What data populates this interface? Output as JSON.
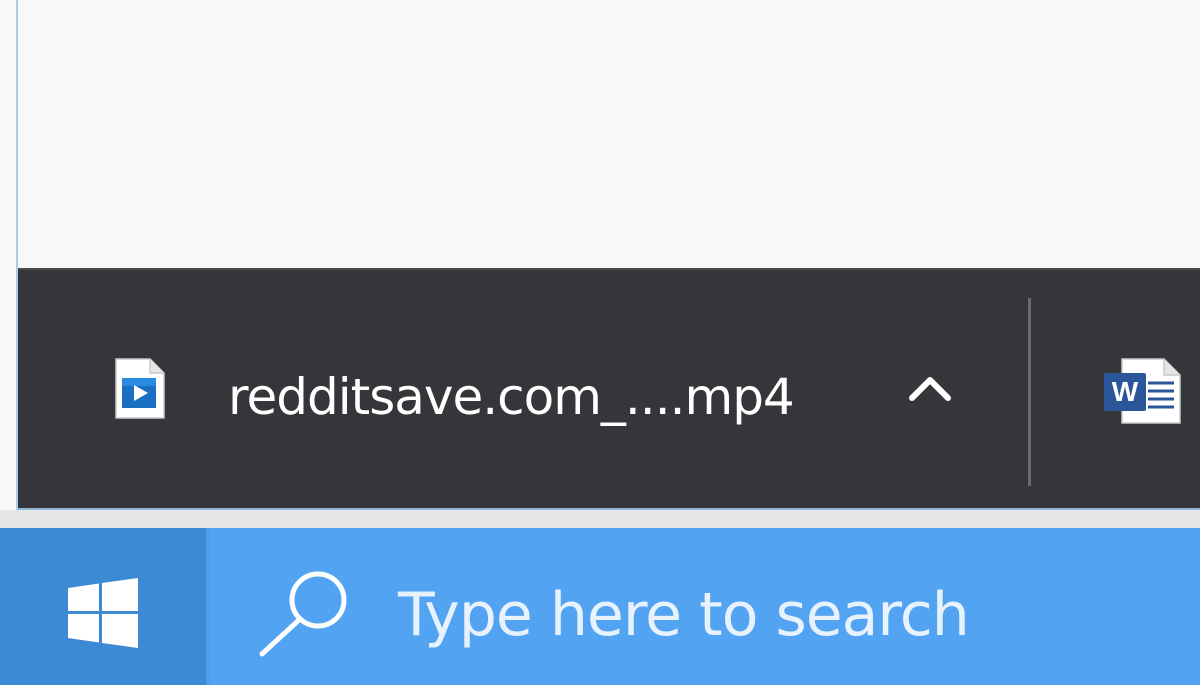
{
  "download_bar": {
    "file_name": "redditsave.com_....mp4",
    "file_icon": "video-file-icon",
    "expand_icon": "chevron-up-icon",
    "next_item_icon": "word-document-icon"
  },
  "taskbar": {
    "start_icon": "windows-logo-icon",
    "search_icon": "magnifier-icon",
    "search_placeholder": "Type here to search"
  },
  "colors": {
    "download_bar_bg": "#35363a",
    "taskbar_bg": "#4aa0ef",
    "start_button_bg": "#3c89d4",
    "page_bg": "#f8f8f8"
  }
}
